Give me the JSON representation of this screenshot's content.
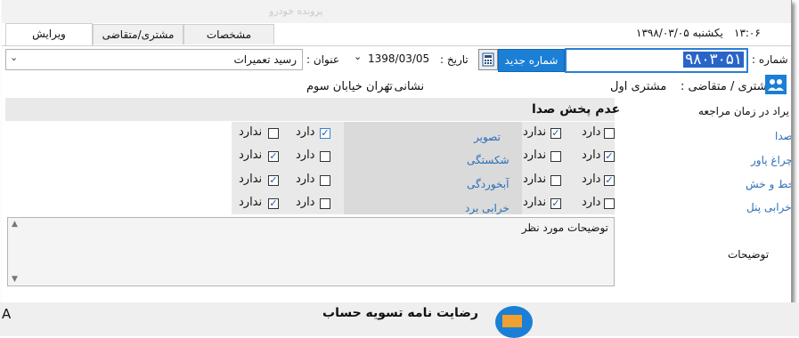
{
  "header": {
    "faded_title": "پرونده خودرو",
    "time": "۱۳:۰۶",
    "date_text": "یکشنبه ۱۳۹۸/۰۳/۰۵"
  },
  "tabs": [
    {
      "label": "ویرایش",
      "active": true
    },
    {
      "label": "مشتری/متقاضی",
      "active": false
    },
    {
      "label": "مشخصات",
      "active": false
    }
  ],
  "form": {
    "number_label": "شماره :",
    "number_value": "۹۸۰۳۰۵۱",
    "new_number_button": "شماره جدید",
    "date_label": "تاریخ :",
    "date_value": "1398/03/05",
    "title_label": "عنوان :",
    "title_value": "رسید تعمیرات",
    "customer_label": "مشتری / متقاضی :",
    "customer_value": "مشتری اول",
    "address_label": "نشانی :",
    "address_value": "تهران خیابان سوم"
  },
  "checklist": {
    "left_header": "یراد در زمان مراجعه",
    "center_header": "عدم پخش صدا",
    "yes_label": "دارد",
    "no_label": "ندارد",
    "right_items": [
      {
        "label": "صدا",
        "has": false,
        "not": true
      },
      {
        "label": "چراغ پاور",
        "has": true,
        "not": false
      },
      {
        "label": "خط و خش",
        "has": true,
        "not": false
      },
      {
        "label": "خرابی پنل",
        "has": false,
        "not": true
      }
    ],
    "left_items": [
      {
        "label": "تصویر",
        "has": true,
        "not": false
      },
      {
        "label": "شکستگی",
        "has": false,
        "not": true
      },
      {
        "label": "آبخوردگی",
        "has": false,
        "not": true
      },
      {
        "label": "خرابی برد",
        "has": false,
        "not": true
      }
    ]
  },
  "notes": {
    "label": "توضیحات",
    "value": "توضیحات مورد نظر"
  },
  "footer": {
    "text": "رضایت نامه تسویه حساب",
    "left_char": "A"
  },
  "colors": {
    "accent": "#1b7fd6",
    "selection": "#2a64c8",
    "link": "#2d6fb8"
  }
}
